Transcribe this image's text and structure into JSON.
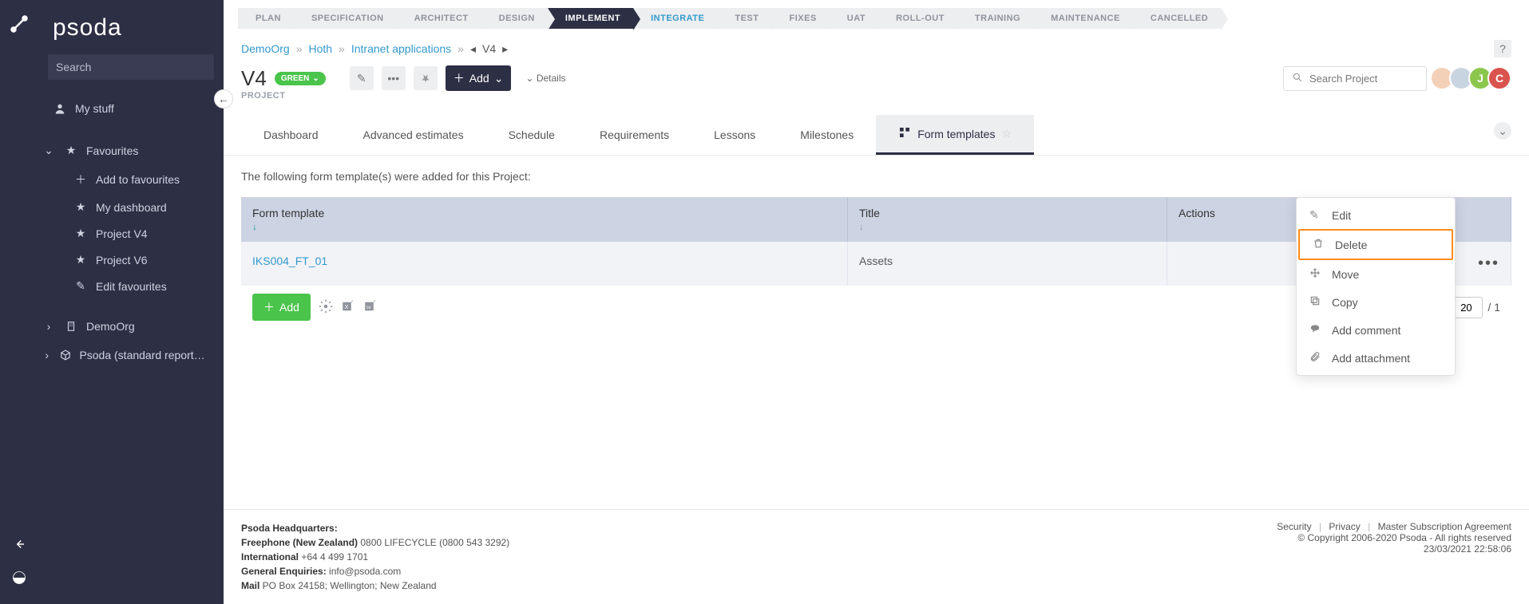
{
  "brand": "psoda",
  "search": {
    "placeholder": "Search"
  },
  "sidebar": {
    "mystuff": "My stuff",
    "favourites": "Favourites",
    "fav_items": [
      {
        "label": "Add to favourites"
      },
      {
        "label": "My dashboard"
      },
      {
        "label": "Project V4"
      },
      {
        "label": "Project V6"
      },
      {
        "label": "Edit favourites"
      }
    ],
    "demoorg": "DemoOrg",
    "psoda_std": "Psoda (standard reports and wor…"
  },
  "phases": [
    "PLAN",
    "SPECIFICATION",
    "ARCHITECT",
    "DESIGN",
    "IMPLEMENT",
    "INTEGRATE",
    "TEST",
    "FIXES",
    "UAT",
    "ROLL-OUT",
    "TRAINING",
    "MAINTENANCE",
    "CANCELLED"
  ],
  "breadcrumb": {
    "demo": "DemoOrg",
    "hoth": "Hoth",
    "intranet": "Intranet applications",
    "current": "V4"
  },
  "title": "V4",
  "status_badge": "GREEN",
  "add_label": "Add",
  "details_label": "Details",
  "search_project_placeholder": "Search Project",
  "subtitle": "PROJECT",
  "tabs": [
    "Dashboard",
    "Advanced estimates",
    "Schedule",
    "Requirements",
    "Lessons",
    "Milestones",
    "Form templates"
  ],
  "lead": "The following form template(s) were added for this Project:",
  "table": {
    "cols": {
      "ft": "Form template",
      "title": "Title",
      "actions": "Actions"
    },
    "rows": [
      {
        "ft": "IKS004_FT_01",
        "title": "Assets"
      }
    ]
  },
  "add_green": "Add",
  "pager": {
    "size": "20",
    "total": "/ 1"
  },
  "context": {
    "edit": "Edit",
    "delete": "Delete",
    "move": "Move",
    "copy": "Copy",
    "comment": "Add comment",
    "attach": "Add attachment"
  },
  "footer": {
    "hq": "Psoda Headquarters:",
    "freephone_lbl": "Freephone (New Zealand)",
    "freephone_val": " 0800 LIFECYCLE (0800 543 3292)",
    "intl_lbl": "International",
    "intl_val": " +64 4 499 1701",
    "enq_lbl": "General Enquiries:",
    "enq_val": " info@psoda.com",
    "mail_lbl": "Mail",
    "mail_val": " PO Box 24158; Wellington; New Zealand",
    "links": {
      "sec": "Security",
      "priv": "Privacy",
      "msa": "Master Subscription Agreement"
    },
    "copyright": "© Copyright 2006-2020 Psoda - All rights reserved",
    "timestamp": "23/03/2021 22:58:06"
  }
}
